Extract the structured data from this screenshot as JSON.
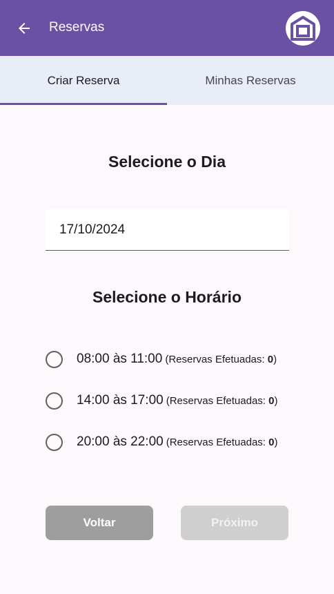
{
  "appbar": {
    "title": "Reservas",
    "back_icon": "arrow-left-icon",
    "home_icon": "home-icon",
    "color": "#6a51a3"
  },
  "tabs": [
    {
      "label": "Criar Reserva",
      "active": true
    },
    {
      "label": "Minhas Reservas",
      "active": false
    }
  ],
  "day_section": {
    "heading": "Selecione o Dia",
    "date_value": "17/10/2024"
  },
  "time_section": {
    "heading": "Selecione o Horário",
    "meta_label": "Reservas Efetuadas:",
    "slots": [
      {
        "time": "08:00 às 11:00",
        "count": "0"
      },
      {
        "time": "14:00 às 17:00",
        "count": "0"
      },
      {
        "time": "20:00 às 22:00",
        "count": "0"
      }
    ]
  },
  "actions": {
    "back_label": "Voltar",
    "next_label": "Próximo"
  }
}
